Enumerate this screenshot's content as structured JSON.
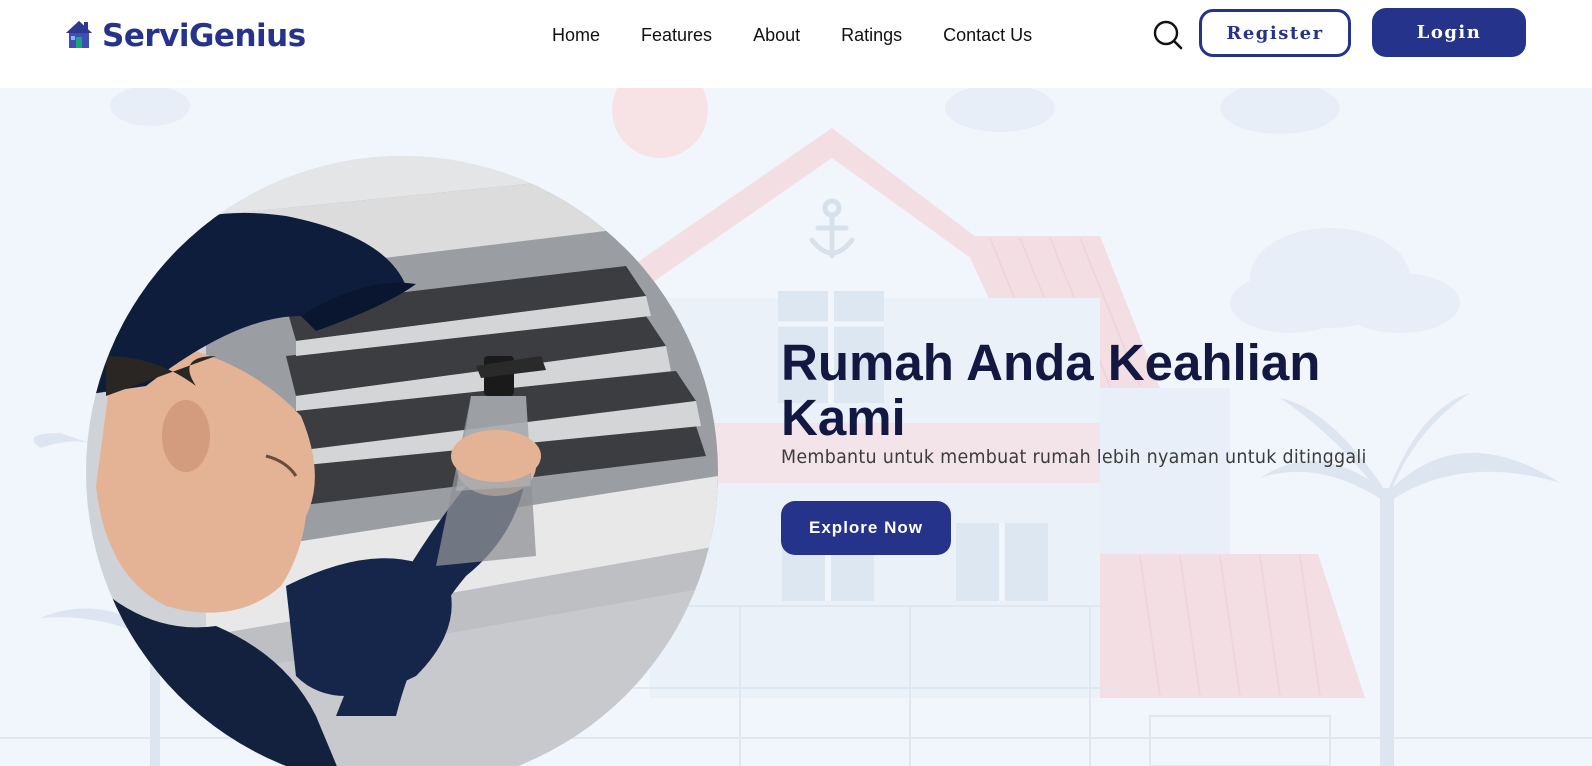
{
  "header": {
    "brand": "ServiGenius",
    "nav": [
      {
        "label": "Home"
      },
      {
        "label": "Features"
      },
      {
        "label": "About"
      },
      {
        "label": "Ratings"
      },
      {
        "label": "Contact Us"
      }
    ],
    "search_icon": "search-icon",
    "register_label": "Register",
    "login_label": "Login"
  },
  "hero": {
    "title": "Rumah Anda Keahlian Kami",
    "subtitle": "Membantu untuk membuat rumah lebih nyaman untuk ditinggali",
    "cta_label": "Explore Now"
  },
  "colors": {
    "brand": "#25338a",
    "title": "#131842",
    "hero_background": "#f1f6fd",
    "header_background": "#ffffff"
  }
}
